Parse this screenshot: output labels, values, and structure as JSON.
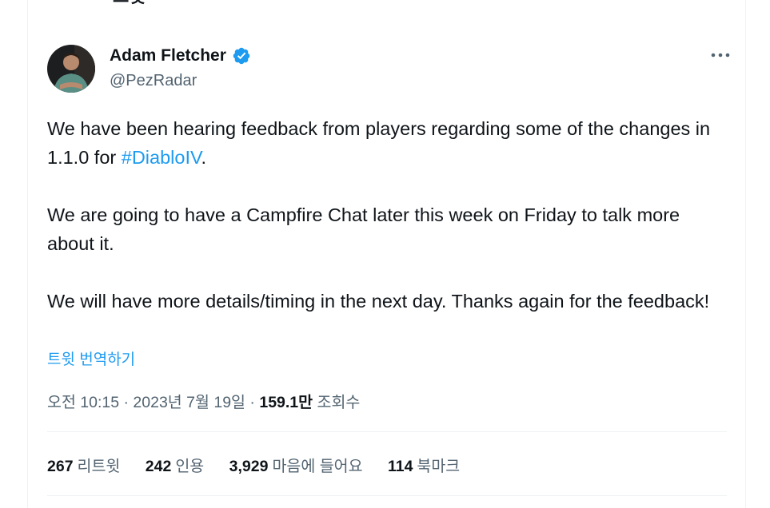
{
  "header": {
    "title": "트윗",
    "back_icon": "arrow-left-icon"
  },
  "author": {
    "display_name": "Adam Fletcher",
    "handle": "@PezRadar",
    "verified": true,
    "verified_color": "#1d9bf0"
  },
  "tweet": {
    "p1_before": "We have been hearing feedback from players regarding some of the changes in 1.1.0 for ",
    "hashtag": "#DiabloIV",
    "p1_after": ".",
    "p2": "We are going to have a Campfire Chat later this week on Friday to talk more about it.",
    "p3": "We will have more details/timing in the next day. Thanks again for the feedback!",
    "translate_label": "트윗 번역하기"
  },
  "meta": {
    "time": "오전 10:15 · 2023년 7월 19일",
    "separator": " · ",
    "views_count": "159.1만",
    "views_label": "조회수"
  },
  "stats": {
    "retweets": {
      "count": "267",
      "label": "리트윗"
    },
    "quotes": {
      "count": "242",
      "label": "인용"
    },
    "likes": {
      "count": "3,929",
      "label": "마음에 들어요"
    },
    "bookmarks": {
      "count": "114",
      "label": "북마크"
    }
  },
  "colors": {
    "link": "#1d9bf0",
    "secondary_text": "#536471",
    "primary_text": "#0f1419",
    "divider": "#eff3f4"
  }
}
